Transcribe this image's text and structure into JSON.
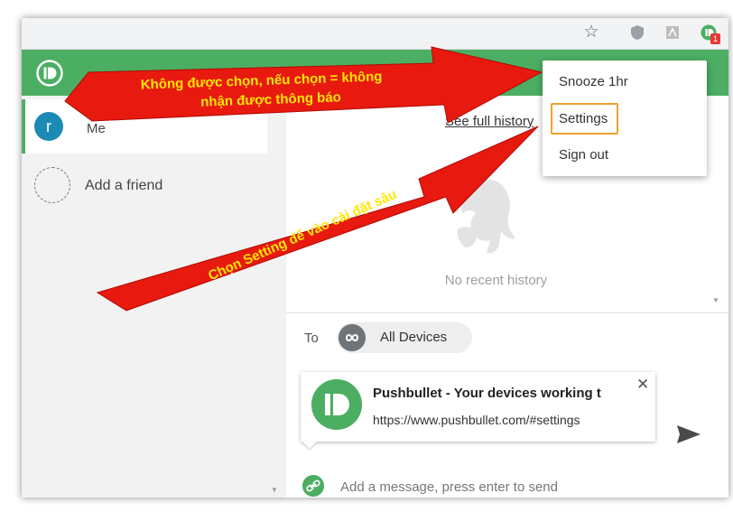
{
  "browser": {
    "toolbar_icons": [
      "star-icon",
      "shield-icon",
      "pdf-icon",
      "pushbullet-extension-icon"
    ],
    "extension_badge": "1"
  },
  "sidebar": {
    "items": [
      {
        "avatar_letter": "r",
        "label": "Me"
      },
      {
        "label": "Add a friend"
      }
    ]
  },
  "history": {
    "see_full_history": "See full history",
    "empty_text": "No recent history"
  },
  "composer": {
    "to_label": "To",
    "target": "All Devices",
    "card_title": "Pushbullet - Your devices working t",
    "card_url": "https://www.pushbullet.com/#settings",
    "close_glyph": "✕",
    "message_placeholder": "Add a message, press enter to send"
  },
  "menu": {
    "items": [
      "Snooze 1hr",
      "Settings",
      "Sign out"
    ]
  },
  "annotations": {
    "arrow1_line1": "Không được chọn, nếu chọn = không",
    "arrow1_line2": "nhận được thông báo",
    "arrow2_text": "Chọn Setting để vào cài đặt sâu"
  },
  "colors": {
    "brand_green": "#4cae62",
    "arrow_red": "#e8190f",
    "arrow_text_yellow": "#ffe600",
    "highlight_orange": "#f0a030"
  }
}
